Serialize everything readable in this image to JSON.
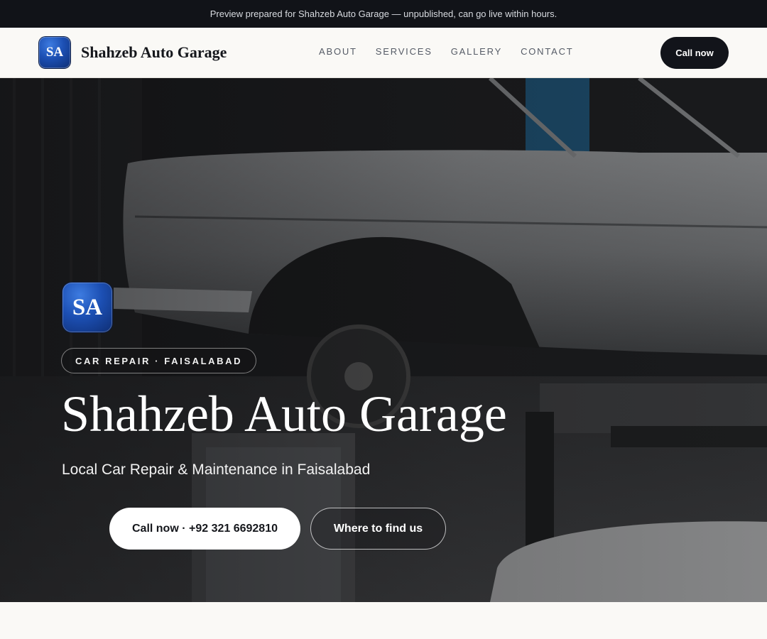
{
  "preview_banner": {
    "text": "Preview prepared for Shahzeb Auto Garage — unpublished, can go live within hours."
  },
  "header": {
    "logo_initials": "SA",
    "brand_name": "Shahzeb Auto Garage",
    "nav": [
      {
        "label": "About"
      },
      {
        "label": "Services"
      },
      {
        "label": "Gallery"
      },
      {
        "label": "Contact"
      }
    ],
    "cta_label": "Call now"
  },
  "hero": {
    "logo_initials": "SA",
    "tag": "CAR REPAIR · FAISALABAD",
    "title": "Shahzeb Auto Garage",
    "subtitle": "Local Car Repair & Maintenance in Faisalabad",
    "primary_button": "Call now · +92 321 6692810",
    "secondary_button": "Where to find us",
    "background_image": "car-on-lift-photo"
  },
  "colors": {
    "logo_blue": "#1c4fb3",
    "dark": "#12141a",
    "page_bg": "#faf9f6"
  }
}
